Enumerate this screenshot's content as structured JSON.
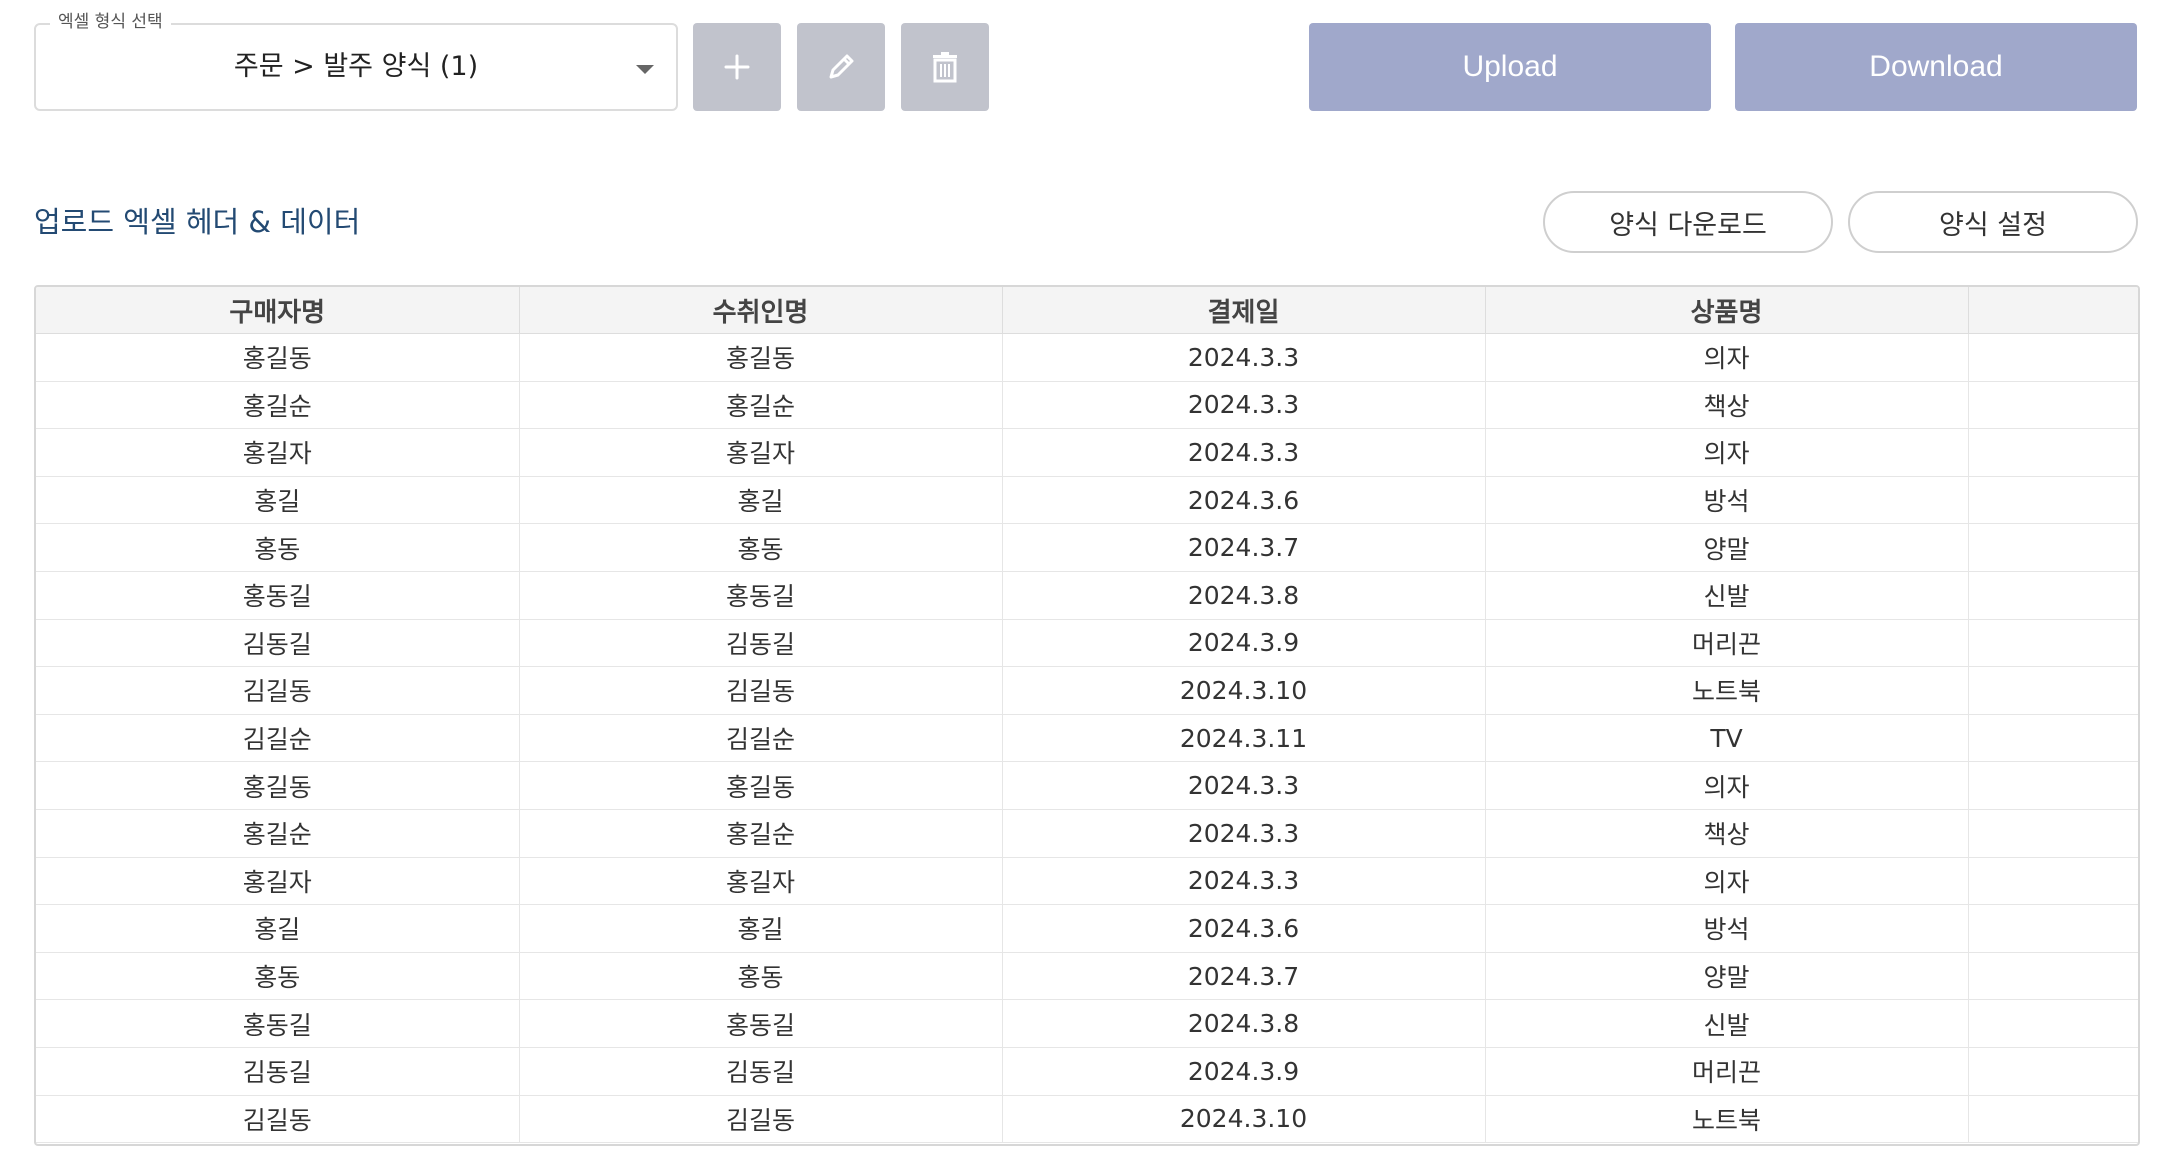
{
  "format_select": {
    "legend": "엑셀 형식 선택",
    "value": "주문 > 발주 양식 (1)"
  },
  "toolbar": {
    "add_icon": "plus-icon",
    "edit_icon": "pencil-icon",
    "delete_icon": "trash-icon",
    "upload_label": "Upload",
    "download_label": "Download"
  },
  "section": {
    "title": "업로드 엑셀 헤더 & 데이터",
    "template_download_label": "양식 다운로드",
    "template_settings_label": "양식 설정"
  },
  "colors": {
    "primary_button": "#a0a8cb",
    "icon_button": "#c1c3cc",
    "section_title": "#234a73"
  },
  "table": {
    "headers": [
      "구매자명",
      "수취인명",
      "결제일",
      "상품명",
      ""
    ],
    "rows": [
      [
        "홍길동",
        "홍길동",
        "2024.3.3",
        "의자",
        ""
      ],
      [
        "홍길순",
        "홍길순",
        "2024.3.3",
        "책상",
        ""
      ],
      [
        "홍길자",
        "홍길자",
        "2024.3.3",
        "의자",
        ""
      ],
      [
        "홍길",
        "홍길",
        "2024.3.6",
        "방석",
        ""
      ],
      [
        "홍동",
        "홍동",
        "2024.3.7",
        "양말",
        ""
      ],
      [
        "홍동길",
        "홍동길",
        "2024.3.8",
        "신발",
        ""
      ],
      [
        "김동길",
        "김동길",
        "2024.3.9",
        "머리끈",
        ""
      ],
      [
        "김길동",
        "김길동",
        "2024.3.10",
        "노트북",
        ""
      ],
      [
        "김길순",
        "김길순",
        "2024.3.11",
        "TV",
        ""
      ],
      [
        "홍길동",
        "홍길동",
        "2024.3.3",
        "의자",
        ""
      ],
      [
        "홍길순",
        "홍길순",
        "2024.3.3",
        "책상",
        ""
      ],
      [
        "홍길자",
        "홍길자",
        "2024.3.3",
        "의자",
        ""
      ],
      [
        "홍길",
        "홍길",
        "2024.3.6",
        "방석",
        ""
      ],
      [
        "홍동",
        "홍동",
        "2024.3.7",
        "양말",
        ""
      ],
      [
        "홍동길",
        "홍동길",
        "2024.3.8",
        "신발",
        ""
      ],
      [
        "김동길",
        "김동길",
        "2024.3.9",
        "머리끈",
        ""
      ],
      [
        "김길동",
        "김길동",
        "2024.3.10",
        "노트북",
        ""
      ]
    ]
  }
}
